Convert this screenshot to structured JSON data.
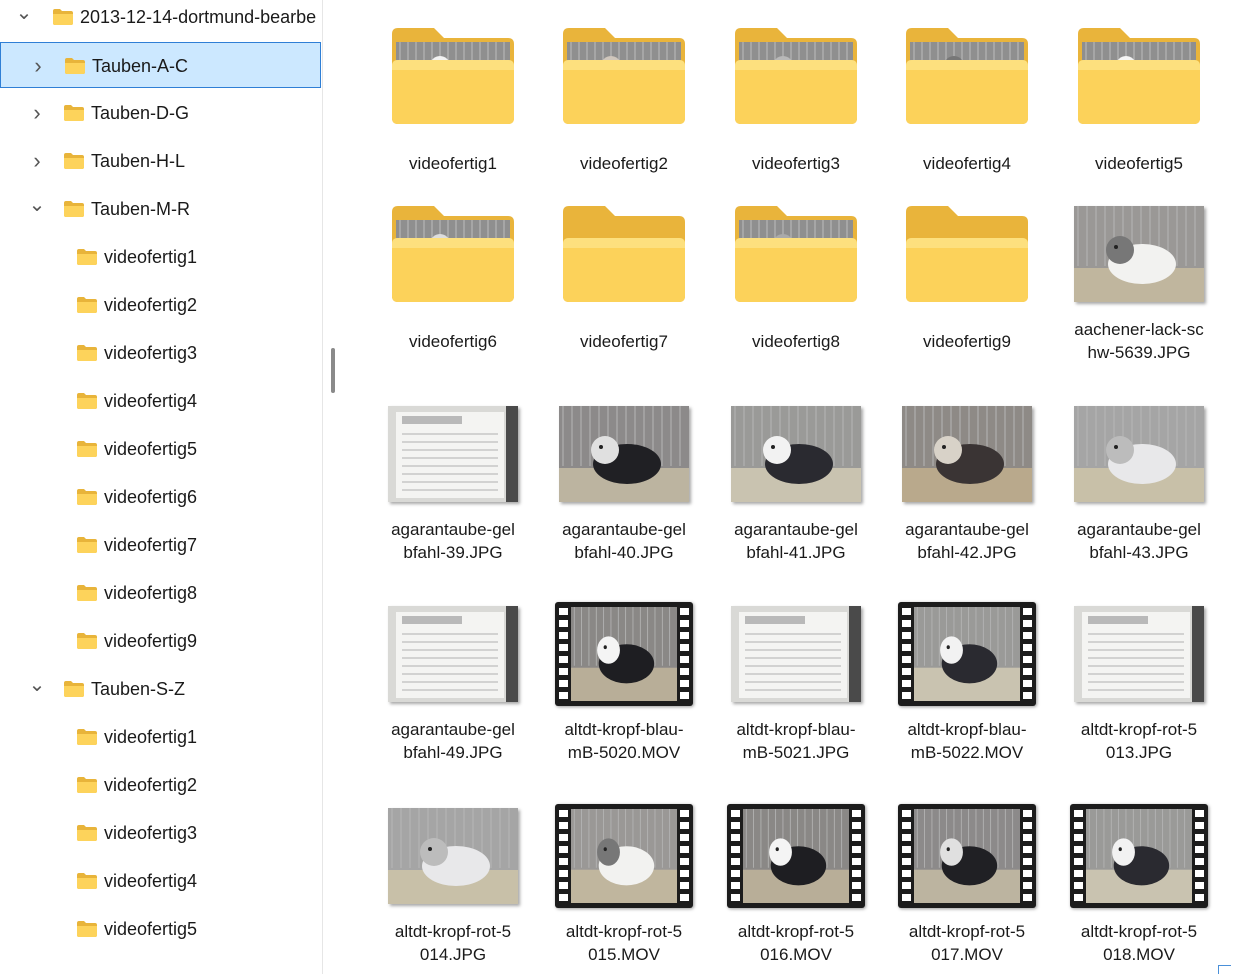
{
  "sidebar": {
    "root": "2013-12-14-dortmund-bearbe",
    "groups": [
      {
        "label": "Tauben-A-C",
        "selected": true
      },
      {
        "label": "Tauben-D-G"
      },
      {
        "label": "Tauben-H-L"
      },
      {
        "label": "Tauben-M-R",
        "children": [
          "videofertig1",
          "videofertig2",
          "videofertig3",
          "videofertig4",
          "videofertig5",
          "videofertig6",
          "videofertig7",
          "videofertig8",
          "videofertig9"
        ]
      },
      {
        "label": "Tauben-S-Z",
        "children": [
          "videofertig1",
          "videofertig2",
          "videofertig3",
          "videofertig4",
          "videofertig5"
        ]
      }
    ]
  },
  "content": {
    "items": [
      {
        "name": "videofertig1",
        "kind": "folder-photo"
      },
      {
        "name": "videofertig2",
        "kind": "folder-photo"
      },
      {
        "name": "videofertig3",
        "kind": "folder-photo"
      },
      {
        "name": "videofertig4",
        "kind": "folder-photo"
      },
      {
        "name": "videofertig5",
        "kind": "folder-photo"
      },
      {
        "name": "videofertig6",
        "kind": "folder-photo"
      },
      {
        "name": "videofertig7",
        "kind": "folder"
      },
      {
        "name": "videofertig8",
        "kind": "folder-photo"
      },
      {
        "name": "videofertig9",
        "kind": "folder"
      },
      {
        "name": "aachener-lack-schw-5639.JPG",
        "line1": "aachener-lack-sc",
        "line2": "hw-5639.JPG",
        "kind": "photo"
      },
      {
        "name": "agarantaube-gelbfahl-39.JPG",
        "line1": "agarantaube-gel",
        "line2": "bfahl-39.JPG",
        "kind": "card"
      },
      {
        "name": "agarantaube-gelbfahl-40.JPG",
        "line1": "agarantaube-gel",
        "line2": "bfahl-40.JPG",
        "kind": "photo"
      },
      {
        "name": "agarantaube-gelbfahl-41.JPG",
        "line1": "agarantaube-gel",
        "line2": "bfahl-41.JPG",
        "kind": "photo"
      },
      {
        "name": "agarantaube-gelbfahl-42.JPG",
        "line1": "agarantaube-gel",
        "line2": "bfahl-42.JPG",
        "kind": "photo"
      },
      {
        "name": "agarantaube-gelbfahl-43.JPG",
        "line1": "agarantaube-gel",
        "line2": "bfahl-43.JPG",
        "kind": "photo"
      },
      {
        "name": "agarantaube-gelbfahl-49.JPG",
        "line1": "agarantaube-gel",
        "line2": "bfahl-49.JPG",
        "kind": "card"
      },
      {
        "name": "altdt-kropf-blau-mB-5020.MOV",
        "line1": "altdt-kropf-blau-",
        "line2": "mB-5020.MOV",
        "kind": "video"
      },
      {
        "name": "altdt-kropf-blau-mB-5021.JPG",
        "line1": "altdt-kropf-blau-",
        "line2": "mB-5021.JPG",
        "kind": "card"
      },
      {
        "name": "altdt-kropf-blau-mB-5022.MOV",
        "line1": "altdt-kropf-blau-",
        "line2": "mB-5022.MOV",
        "kind": "video"
      },
      {
        "name": "altdt-kropf-rot-5013.JPG",
        "line1": "altdt-kropf-rot-5",
        "line2": "013.JPG",
        "kind": "card"
      },
      {
        "name": "altdt-kropf-rot-5014.JPG",
        "line1": "altdt-kropf-rot-5",
        "line2": "014.JPG",
        "kind": "photo"
      },
      {
        "name": "altdt-kropf-rot-5015.MOV",
        "line1": "altdt-kropf-rot-5",
        "line2": "015.MOV",
        "kind": "video"
      },
      {
        "name": "altdt-kropf-rot-5016.MOV",
        "line1": "altdt-kropf-rot-5",
        "line2": "016.MOV",
        "kind": "video"
      },
      {
        "name": "altdt-kropf-rot-5017.MOV",
        "line1": "altdt-kropf-rot-5",
        "line2": "017.MOV",
        "kind": "video"
      },
      {
        "name": "altdt-kropf-rot-5018.MOV",
        "line1": "altdt-kropf-rot-5",
        "line2": "018.MOV",
        "kind": "video"
      }
    ]
  },
  "colors": {
    "selected_bg": "#cce8ff",
    "selected_border": "#2f7fd6",
    "folder": "#fdd35b"
  }
}
